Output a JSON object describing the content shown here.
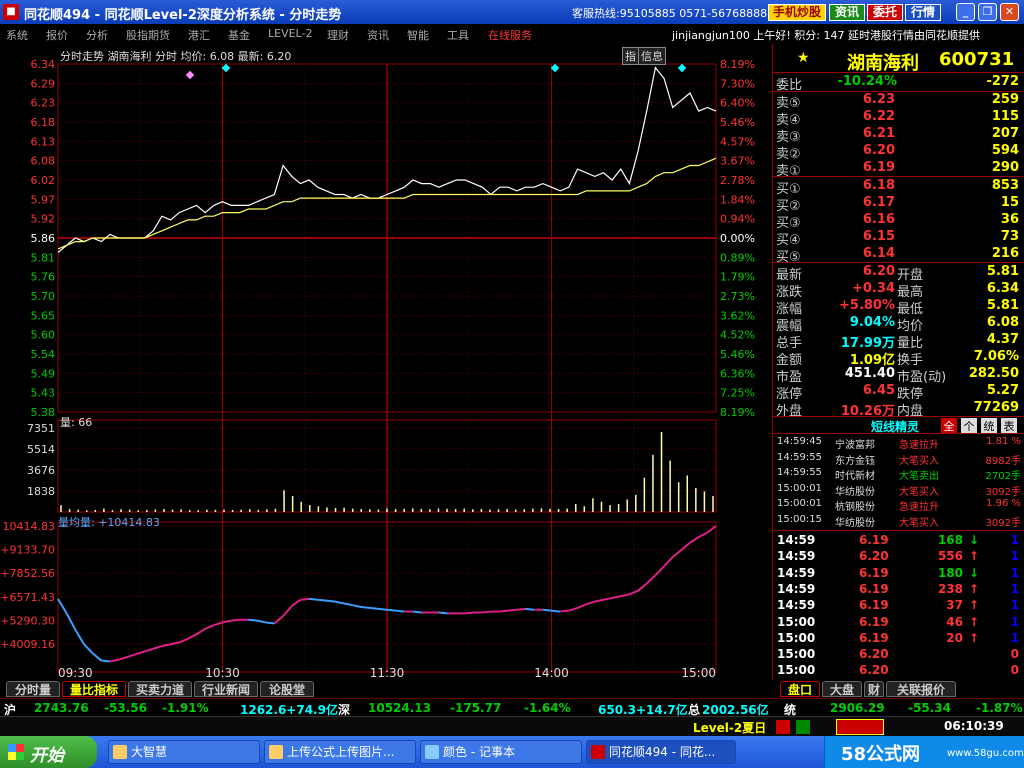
{
  "titlebar": {
    "title": "同花顺494 - 同花顺Level-2深度分析系统 - 分时走势",
    "logo": "■",
    "hotline": "客服热线:95105885 0571-56768888",
    "btn_phone": "手机炒股",
    "btn_info": "资讯",
    "btn_trust": "委托",
    "btn_quote": "行情"
  },
  "menubar": {
    "items": [
      "系统",
      "报价",
      "分析",
      "股指期货",
      "港汇",
      "基金",
      "LEVEL-2",
      "理财",
      "资讯",
      "智能",
      "工具",
      "在线服务"
    ],
    "greeting": "jinjiangjun100 上午好! 积分: 147 延时港股行情由同花顺提供"
  },
  "chart_header": {
    "text": "分时走势  湖南海利 分时 均价: 6.08 最新: 6.20",
    "vol_label": "量: 66",
    "vol_ratio_label": "量均量: +10414.83"
  },
  "chart_icons": {
    "zhi": "指",
    "xinxi": "信息"
  },
  "chart_data": [
    {
      "type": "line",
      "title": "分时走势 湖南海利",
      "ylim": [
        5.38,
        6.34
      ],
      "y_ticks": [
        "6.34",
        "6.29",
        "6.23",
        "6.18",
        "6.13",
        "6.08",
        "6.02",
        "5.97",
        "5.92",
        "5.86",
        "5.81",
        "5.76",
        "5.70",
        "5.65",
        "5.60",
        "5.54",
        "5.49",
        "5.43",
        "5.38"
      ],
      "pct_ticks": [
        "8.19%",
        "7.30%",
        "6.40%",
        "5.46%",
        "4.57%",
        "3.67%",
        "2.78%",
        "1.84%",
        "0.94%",
        "0.00%",
        "0.89%",
        "1.79%",
        "2.73%",
        "3.62%",
        "4.52%",
        "5.46%",
        "6.36%",
        "7.25%",
        "8.19%"
      ],
      "x_ticks": [
        "09:30",
        "10:30",
        "11:30",
        "14:00",
        "15:00"
      ],
      "series": [
        {
          "name": "价格",
          "color": "#ffffff",
          "values": [
            5.82,
            5.84,
            5.86,
            5.85,
            5.86,
            5.85,
            5.87,
            5.86,
            5.86,
            5.86,
            5.86,
            5.88,
            5.92,
            5.91,
            5.93,
            5.94,
            5.95,
            5.93,
            5.95,
            5.96,
            5.95,
            5.95,
            5.95,
            5.96,
            5.97,
            5.98,
            6.06,
            6.03,
            6.01,
            6.02,
            6.0,
            5.99,
            5.98,
            5.98,
            5.97,
            5.98,
            5.97,
            5.97,
            5.98,
            5.99,
            6.0,
            6.02,
            6.01,
            6.01,
            6.0,
            6.01,
            6.02,
            6.02,
            6.01,
            6.0,
            5.98,
            6.0,
            6.0,
            5.99,
            6.0,
            6.0,
            6.01,
            6.0,
            5.99,
            6.0,
            6.05,
            6.04,
            6.03,
            6.04,
            6.02,
            6.05,
            6.01,
            6.1,
            6.21,
            6.33,
            6.3,
            6.22,
            6.24,
            6.26,
            6.21,
            6.22,
            6.21
          ]
        },
        {
          "name": "均价",
          "color": "#ffff66",
          "values": [
            5.83,
            5.84,
            5.85,
            5.85,
            5.86,
            5.86,
            5.86,
            5.86,
            5.86,
            5.86,
            5.86,
            5.87,
            5.88,
            5.89,
            5.9,
            5.91,
            5.91,
            5.92,
            5.92,
            5.93,
            5.93,
            5.93,
            5.94,
            5.94,
            5.94,
            5.95,
            5.96,
            5.96,
            5.97,
            5.97,
            5.97,
            5.97,
            5.97,
            5.97,
            5.97,
            5.97,
            5.97,
            5.97,
            5.97,
            5.97,
            5.97,
            5.98,
            5.98,
            5.98,
            5.98,
            5.98,
            5.98,
            5.98,
            5.98,
            5.98,
            5.98,
            5.98,
            5.98,
            5.98,
            5.98,
            5.98,
            5.98,
            5.98,
            5.98,
            5.98,
            5.98,
            5.99,
            5.99,
            5.99,
            5.99,
            5.99,
            5.99,
            6.0,
            6.01,
            6.03,
            6.04,
            6.04,
            6.05,
            6.06,
            6.06,
            6.07,
            6.08
          ]
        }
      ]
    },
    {
      "type": "bar",
      "title": "量",
      "y_ticks": [
        "7351",
        "5514",
        "3676",
        "1838"
      ],
      "ylim": [
        0,
        7351
      ],
      "values": [
        600,
        250,
        200,
        150,
        180,
        300,
        160,
        240,
        200,
        150,
        180,
        220,
        260,
        200,
        240,
        180,
        160,
        200,
        190,
        210,
        180,
        200,
        250,
        190,
        230,
        280,
        1900,
        1400,
        900,
        600,
        500,
        400,
        350,
        380,
        300,
        260,
        240,
        220,
        300,
        260,
        280,
        320,
        260,
        240,
        300,
        280,
        260,
        300,
        240,
        260,
        220,
        240,
        260,
        220,
        240,
        300,
        320,
        280,
        260,
        300,
        700,
        500,
        1200,
        900,
        600,
        700,
        1100,
        1500,
        3000,
        5000,
        7000,
        4500,
        2600,
        3200,
        2100,
        1800,
        1400
      ]
    },
    {
      "type": "line",
      "title": "量比",
      "y_ticks": [
        "10414.83",
        "+9133.70",
        "+7852.56",
        "+6571.43",
        "+5290.30",
        "+4009.16"
      ],
      "ylim": [
        2700,
        10414.83
      ],
      "values": [
        6400,
        5600,
        4700,
        3900,
        3400,
        3000,
        2950,
        3050,
        3200,
        3350,
        3500,
        3650,
        3800,
        3900,
        4000,
        4200,
        4450,
        4750,
        4950,
        5100,
        5200,
        5250,
        5250,
        5200,
        5100,
        5050,
        5450,
        6000,
        6350,
        6400,
        6350,
        6300,
        6250,
        6150,
        6050,
        5950,
        5900,
        5850,
        5800,
        5750,
        5700,
        5700,
        5650,
        5650,
        5650,
        5600,
        5600,
        5600,
        5650,
        5650,
        5700,
        5700,
        5750,
        5800,
        5850,
        5800,
        5800,
        5750,
        5700,
        5750,
        5900,
        6100,
        6250,
        6350,
        6450,
        6550,
        6650,
        6850,
        7250,
        7700,
        8200,
        8700,
        9100,
        9500,
        9800,
        10050,
        10414
      ]
    }
  ],
  "right_panel": {
    "stock_name": "湖南海利",
    "stock_code": "600731",
    "star": "★",
    "weibi": {
      "label": "委比",
      "pct": "-10.24%",
      "val": "-272"
    },
    "sells": [
      {
        "label": "卖⑤",
        "price": "6.23",
        "vol": "259"
      },
      {
        "label": "卖④",
        "price": "6.22",
        "vol": "115"
      },
      {
        "label": "卖③",
        "price": "6.21",
        "vol": "207"
      },
      {
        "label": "卖②",
        "price": "6.20",
        "vol": "594"
      },
      {
        "label": "卖①",
        "price": "6.19",
        "vol": "290"
      }
    ],
    "buys": [
      {
        "label": "买①",
        "price": "6.18",
        "vol": "853"
      },
      {
        "label": "买②",
        "price": "6.17",
        "vol": "15"
      },
      {
        "label": "买③",
        "price": "6.16",
        "vol": "36"
      },
      {
        "label": "买④",
        "price": "6.15",
        "vol": "73"
      },
      {
        "label": "买⑤",
        "price": "6.14",
        "vol": "216"
      }
    ],
    "stats": [
      {
        "l1": "最新",
        "v1": "6.20",
        "l2": "开盘",
        "v2": "5.81"
      },
      {
        "l1": "涨跌",
        "v1": "+0.34",
        "l2": "最高",
        "v2": "6.34"
      },
      {
        "l1": "涨幅",
        "v1": "+5.80%",
        "l2": "最低",
        "v2": "5.81"
      },
      {
        "l1": "震幅",
        "v1": "9.04%",
        "l2": "均价",
        "v2": "6.08"
      },
      {
        "l1": "总手",
        "v1": "17.99万",
        "l2": "量比",
        "v2": "4.37"
      },
      {
        "l1": "金额",
        "v1": "1.09亿",
        "l2": "换手",
        "v2": "7.06%"
      },
      {
        "l1": "市盈",
        "v1": "451.40",
        "l2": "市盈(动)",
        "v2": "282.50"
      },
      {
        "l1": "涨停",
        "v1": "6.45",
        "l2": "跌停",
        "v2": "5.27"
      },
      {
        "l1": "外盘",
        "v1": "10.26万",
        "l2": "内盘",
        "v2": "77269"
      }
    ],
    "short_title": "短线精灵",
    "short_tabs": [
      "全",
      "个",
      "统",
      "表"
    ],
    "ticker": [
      {
        "t": "14:59:45",
        "n": "宁波富邦",
        "e": "急速拉升",
        "v": "1.81 %"
      },
      {
        "t": "14:59:55",
        "n": "东方金钰",
        "e": "大笔买入",
        "v": "8982手"
      },
      {
        "t": "14:59:55",
        "n": "时代新材",
        "e": "大笔卖出",
        "v": "2702手"
      },
      {
        "t": "15:00:01",
        "n": "华纺股份",
        "e": "大笔买入",
        "v": "3092手"
      },
      {
        "t": "15:00:01",
        "n": "杭钢股份",
        "e": "急速拉升",
        "v": "1.96 %"
      },
      {
        "t": "15:00:15",
        "n": "华纺股份",
        "e": "大笔买入",
        "v": "3092手"
      }
    ],
    "trades": [
      {
        "t": "14:59",
        "p": "6.19",
        "v": "168",
        "d": "↓",
        "n": "1"
      },
      {
        "t": "14:59",
        "p": "6.20",
        "v": "556",
        "d": "↑",
        "n": "1"
      },
      {
        "t": "14:59",
        "p": "6.19",
        "v": "180",
        "d": "↓",
        "n": "1"
      },
      {
        "t": "14:59",
        "p": "6.19",
        "v": "238",
        "d": "↑",
        "n": "1"
      },
      {
        "t": "14:59",
        "p": "6.19",
        "v": "37",
        "d": "↑",
        "n": "1"
      },
      {
        "t": "15:00",
        "p": "6.19",
        "v": "46",
        "d": "↑",
        "n": "1"
      },
      {
        "t": "15:00",
        "p": "6.19",
        "v": "20",
        "d": "↑",
        "n": "1"
      },
      {
        "t": "15:00",
        "p": "6.20",
        "v": "",
        "d": "",
        "n": "0"
      },
      {
        "t": "15:00",
        "p": "6.20",
        "v": "",
        "d": "",
        "n": "0"
      }
    ]
  },
  "bottom_tabs": [
    "分时量",
    "量比指标",
    "买卖力道",
    "行业新闻",
    "论股堂"
  ],
  "right_tabs": [
    "盘口",
    "大盘",
    "财",
    "关联报价"
  ],
  "index_bar": {
    "sh": "沪",
    "sh_val": "2743.76",
    "sh_chg": "-53.56",
    "sh_pct": "-1.91%",
    "sh_amt": "1262.6+74.9亿",
    "sz": "深",
    "sz_val": "10524.13",
    "sz_chg": "-175.77",
    "sz_pct": "-1.64%",
    "sz_amt": "650.3+14.7亿",
    "zong": "总",
    "zong_val": "2002.56亿",
    "tong": "统",
    "tong_val": "2906.29",
    "tong_chg": "-55.34",
    "tong_pct": "-1.87%"
  },
  "status": {
    "level2": "Level-2夏日",
    "time": "06:10:39"
  },
  "taskbar": {
    "start": "开始",
    "tasks": [
      "大智慧",
      "上传公式上传图片...",
      "颜色 - 记事本",
      "同花顺494 - 同花..."
    ],
    "watermark": "58公式网",
    "site": "www.58gu.com"
  }
}
